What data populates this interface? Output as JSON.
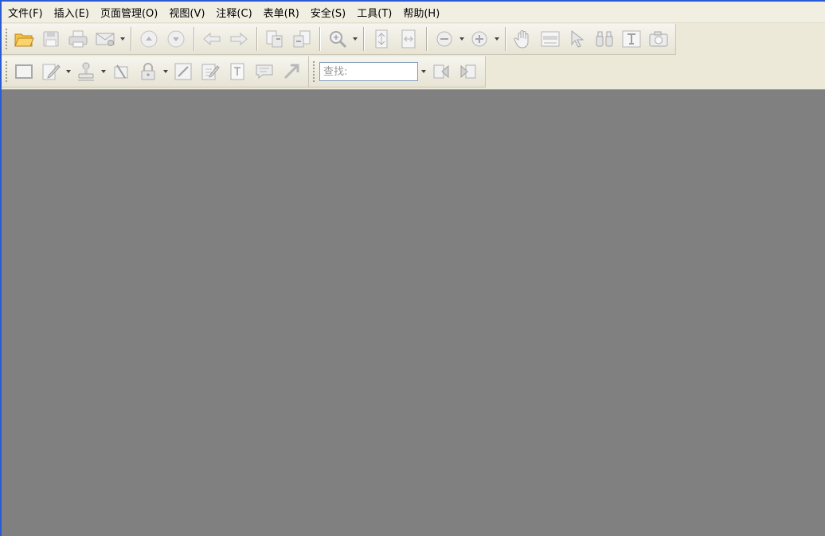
{
  "menu": [
    {
      "label": "文件(F)"
    },
    {
      "label": "插入(E)"
    },
    {
      "label": "页面管理(O)"
    },
    {
      "label": "视图(V)"
    },
    {
      "label": "注释(C)"
    },
    {
      "label": "表单(R)"
    },
    {
      "label": "安全(S)"
    },
    {
      "label": "工具(T)"
    },
    {
      "label": "帮助(H)"
    }
  ],
  "toolbar1": {
    "icons": [
      "open-folder-icon",
      "save-icon",
      "print-icon",
      "email-icon",
      "previous-page-icon",
      "next-page-icon",
      "back-icon",
      "forward-icon",
      "extract-pages-icon",
      "insert-pages-icon",
      "zoom-in-icon",
      "fit-page-icon",
      "fit-width-icon",
      "zoom-out-icon",
      "zoom-plus-icon",
      "hand-tool-icon",
      "text-select-icon",
      "pointer-icon",
      "binoculars-icon",
      "typewriter-icon",
      "snapshot-camera-icon"
    ]
  },
  "toolbar2": {
    "icons": [
      "rectangle-icon",
      "note-pencil-icon",
      "stamp-icon",
      "attach-icon",
      "lock-icon",
      "sign-icon",
      "edit-doc-icon",
      "textbox-icon",
      "comment-icon",
      "arrow-icon",
      "find-prev-icon",
      "find-next-icon"
    ]
  },
  "search": {
    "placeholder": "查找:"
  },
  "colors": {
    "titlebar_border": "#2a5bd7",
    "menubar_bg": "#f1efe2",
    "toolbar_bg": "#ece9d8",
    "workspace_bg": "#808080"
  }
}
